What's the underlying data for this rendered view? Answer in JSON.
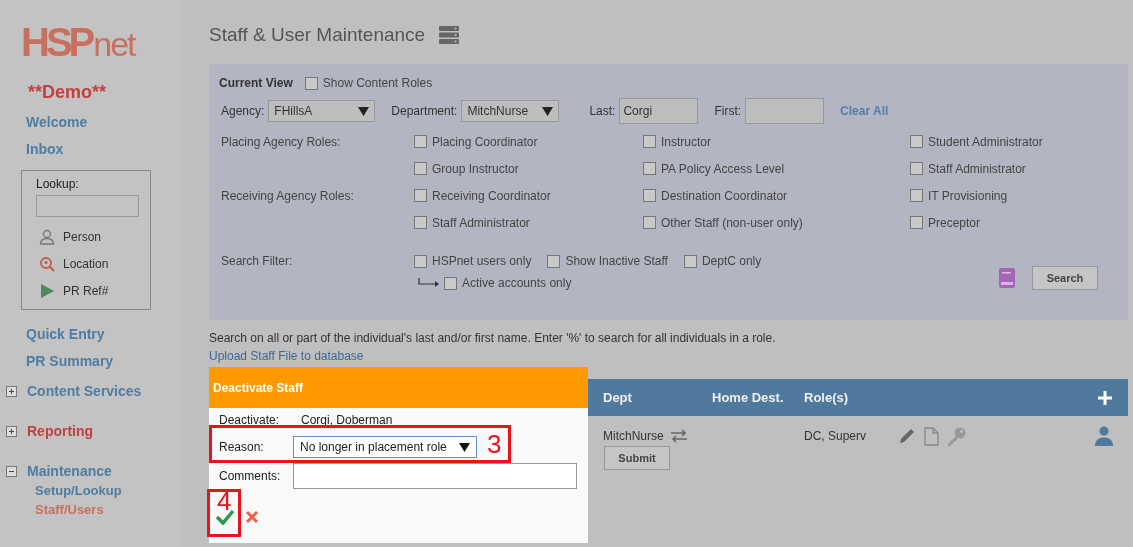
{
  "sidebar": {
    "logo": {
      "part_a": "HSP",
      "part_b": "net"
    },
    "demo_label": "**Demo**",
    "top_links": [
      {
        "label": "Welcome"
      },
      {
        "label": "Inbox"
      }
    ],
    "lookup": {
      "label": "Lookup:",
      "items": [
        {
          "kind": "person",
          "label": "Person"
        },
        {
          "kind": "location",
          "label": "Location"
        },
        {
          "kind": "pr",
          "label": "PR Ref#"
        }
      ]
    },
    "mid_links": [
      {
        "label": "Quick Entry"
      },
      {
        "label": "PR Summary"
      }
    ],
    "sections": [
      {
        "label": "Content Services",
        "expanded": false,
        "highlighted": false
      },
      {
        "label": "Reporting",
        "expanded": false,
        "highlighted": true
      },
      {
        "label": "Maintenance",
        "expanded": true,
        "highlighted": false,
        "children": [
          {
            "label": "Setup/Lookup",
            "selected": false
          },
          {
            "label": "Staff/Users",
            "selected": true
          }
        ]
      }
    ]
  },
  "main": {
    "title": "Staff & User Maintenance",
    "filter": {
      "current_view": "Current View",
      "show_content_roles": {
        "label": "Show Content Roles",
        "checked": false
      },
      "agency": {
        "label": "Agency:",
        "value": "FHillsA"
      },
      "department": {
        "label": "Department:",
        "value": "MitchNurse"
      },
      "last": {
        "label": "Last:",
        "value": "Corgi"
      },
      "first": {
        "label": "First:"
      },
      "clear_all": "Clear All",
      "role_groups": [
        {
          "label": "Placing Agency Roles:",
          "roles": [
            {
              "label": "Placing Coordinator",
              "checked": false
            },
            {
              "label": "Instructor",
              "checked": false
            },
            {
              "label": "Student Administrator",
              "checked": false
            },
            {
              "label": "Group Instructor",
              "checked": false
            },
            {
              "label": "PA Policy Access Level",
              "checked": false
            },
            {
              "label": "Staff Administrator",
              "checked": false
            }
          ]
        },
        {
          "label": "Receiving Agency Roles:",
          "roles": [
            {
              "label": "Receiving Coordinator",
              "checked": false
            },
            {
              "label": "Destination Coordinator",
              "checked": false
            },
            {
              "label": "IT Provisioning",
              "checked": false
            },
            {
              "label": "Staff Administrator",
              "checked": false
            },
            {
              "label": "Other Staff (non-user only)",
              "checked": false
            },
            {
              "label": "Preceptor",
              "checked": false
            }
          ]
        }
      ],
      "search_filter": {
        "label": "Search Filter:",
        "options": [
          {
            "label": "HSPnet users only",
            "checked": false
          },
          {
            "label": "Show Inactive Staff",
            "checked": false
          },
          {
            "label": "DeptC only",
            "checked": false
          }
        ],
        "sub_option": {
          "label": "Active accounts only",
          "checked": false
        }
      },
      "search_button": "Search"
    },
    "hint": "Search on all or part of the individual's last and/or first name. Enter '%' to search for all individuals in a role.",
    "upload_link": "Upload Staff File to database",
    "table": {
      "columns": [
        "Dept",
        "Home Dest.",
        "Role(s)"
      ],
      "rows": [
        {
          "dept": "MitchNurse",
          "roles": "DC, Superv"
        }
      ],
      "submit_button": "Submit"
    }
  },
  "dialog": {
    "title": "Deactivate Staff",
    "deactivate_label": "Deactivate:",
    "deactivate_value": "Corgi, Doberman",
    "reason_label": "Reason:",
    "reason_value": "No longer in placement role",
    "comments_label": "Comments:",
    "annotations": [
      {
        "kind": "reason",
        "number": "3"
      },
      {
        "kind": "confirm",
        "number": "4"
      }
    ]
  }
}
